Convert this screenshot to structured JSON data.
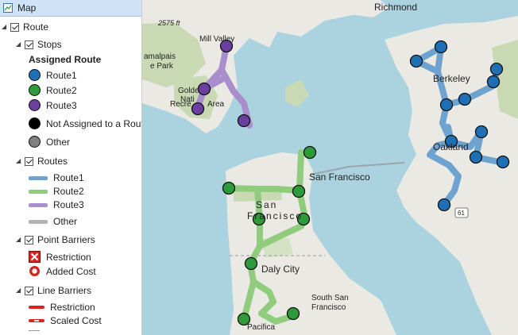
{
  "toc": {
    "map_label": "Map",
    "route_label": "Route",
    "stops": {
      "label": "Stops",
      "heading": "Assigned Route",
      "items": [
        {
          "label": "Route1",
          "color": "#1f6fb4"
        },
        {
          "label": "Route2",
          "color": "#2e9a3a"
        },
        {
          "label": "Route3",
          "color": "#6b3fa0"
        },
        {
          "label": "Not Assigned to a Route",
          "color": "#000000"
        },
        {
          "label": "Other",
          "color": "#808080"
        }
      ]
    },
    "routes": {
      "label": "Routes",
      "items": [
        {
          "label": "Route1",
          "color": "#6fa3cf"
        },
        {
          "label": "Route2",
          "color": "#8fcc7e"
        },
        {
          "label": "Route3",
          "color": "#a88fcc"
        },
        {
          "label": "Other",
          "color": "#b3b3b3"
        }
      ]
    },
    "point_barriers": {
      "label": "Point Barriers",
      "items": [
        {
          "label": "Restriction",
          "icon": "restriction-x-icon"
        },
        {
          "label": "Added Cost",
          "icon": "added-cost-ring-icon"
        }
      ]
    },
    "line_barriers": {
      "label": "Line Barriers",
      "items": [
        {
          "label": "Restriction",
          "icon": "restriction-line-icon"
        },
        {
          "label": "Scaled Cost",
          "icon": "scaled-cost-line-icon"
        }
      ]
    }
  },
  "map": {
    "labels": {
      "richmond": "Richmond",
      "mill_valley": "Mill Valley",
      "elevation": "2575 ft",
      "tamalpais_1": "amalpais",
      "tamalpais_2": "e Park",
      "golden_gate_1": "Golde",
      "golden_gate_2": "Nati",
      "golden_gate_3": "Recre",
      "golden_gate_4": "Area",
      "berkeley": "Berkeley",
      "oakland": "Oakland",
      "san_francisco": "San Francisco",
      "sf_watermark_1": "San",
      "sf_watermark_2": "Francisco",
      "daly_city": "Daly City",
      "south_sf_1": "South San",
      "south_sf_2": "Francisco",
      "pacifica": "Pacifica",
      "hwy_61": "61"
    },
    "colors": {
      "water": "#aad3df",
      "land": "#ebe9e3",
      "park": "#c9d9b4",
      "route1_line": "#6fa3cf",
      "route2_line": "#8fcc7e",
      "route3_line": "#a88fcc",
      "route1_stop": "#1f6fb4",
      "route2_stop": "#2e9a3a",
      "route3_stop": "#6b3fa0"
    }
  }
}
